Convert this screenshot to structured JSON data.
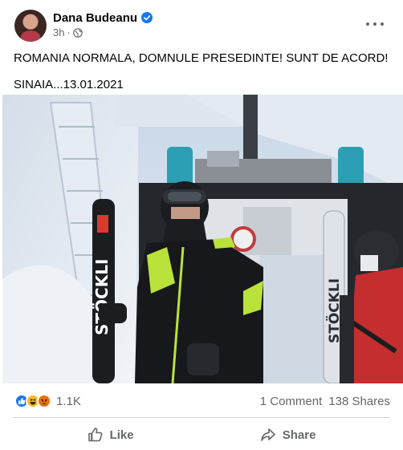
{
  "post": {
    "author": "Dana Budeanu",
    "time": "3h",
    "separator": "·",
    "text_line1": "ROMANIA NORMALA, DOMNULE PRESEDINTE! SUNT DE ACORD!",
    "text_line2": "SINAIA...13.01.2021"
  },
  "photo": {
    "ski_brand_left": "STÖCKLI",
    "ski_brand_right": "STÖCKLI"
  },
  "stats": {
    "reaction_count": "1.1K",
    "comments": "1 Comment",
    "shares": "138 Shares"
  },
  "actions": {
    "like_label": "Like",
    "share_label": "Share"
  },
  "colors": {
    "facebook_blue": "#1877f2",
    "secondary_text": "#65676b"
  },
  "icons": [
    "verified-icon",
    "globe-icon",
    "more-icon",
    "like-reaction-icon",
    "haha-reaction-icon",
    "angry-reaction-icon",
    "thumbs-up-icon",
    "share-arrow-icon"
  ]
}
